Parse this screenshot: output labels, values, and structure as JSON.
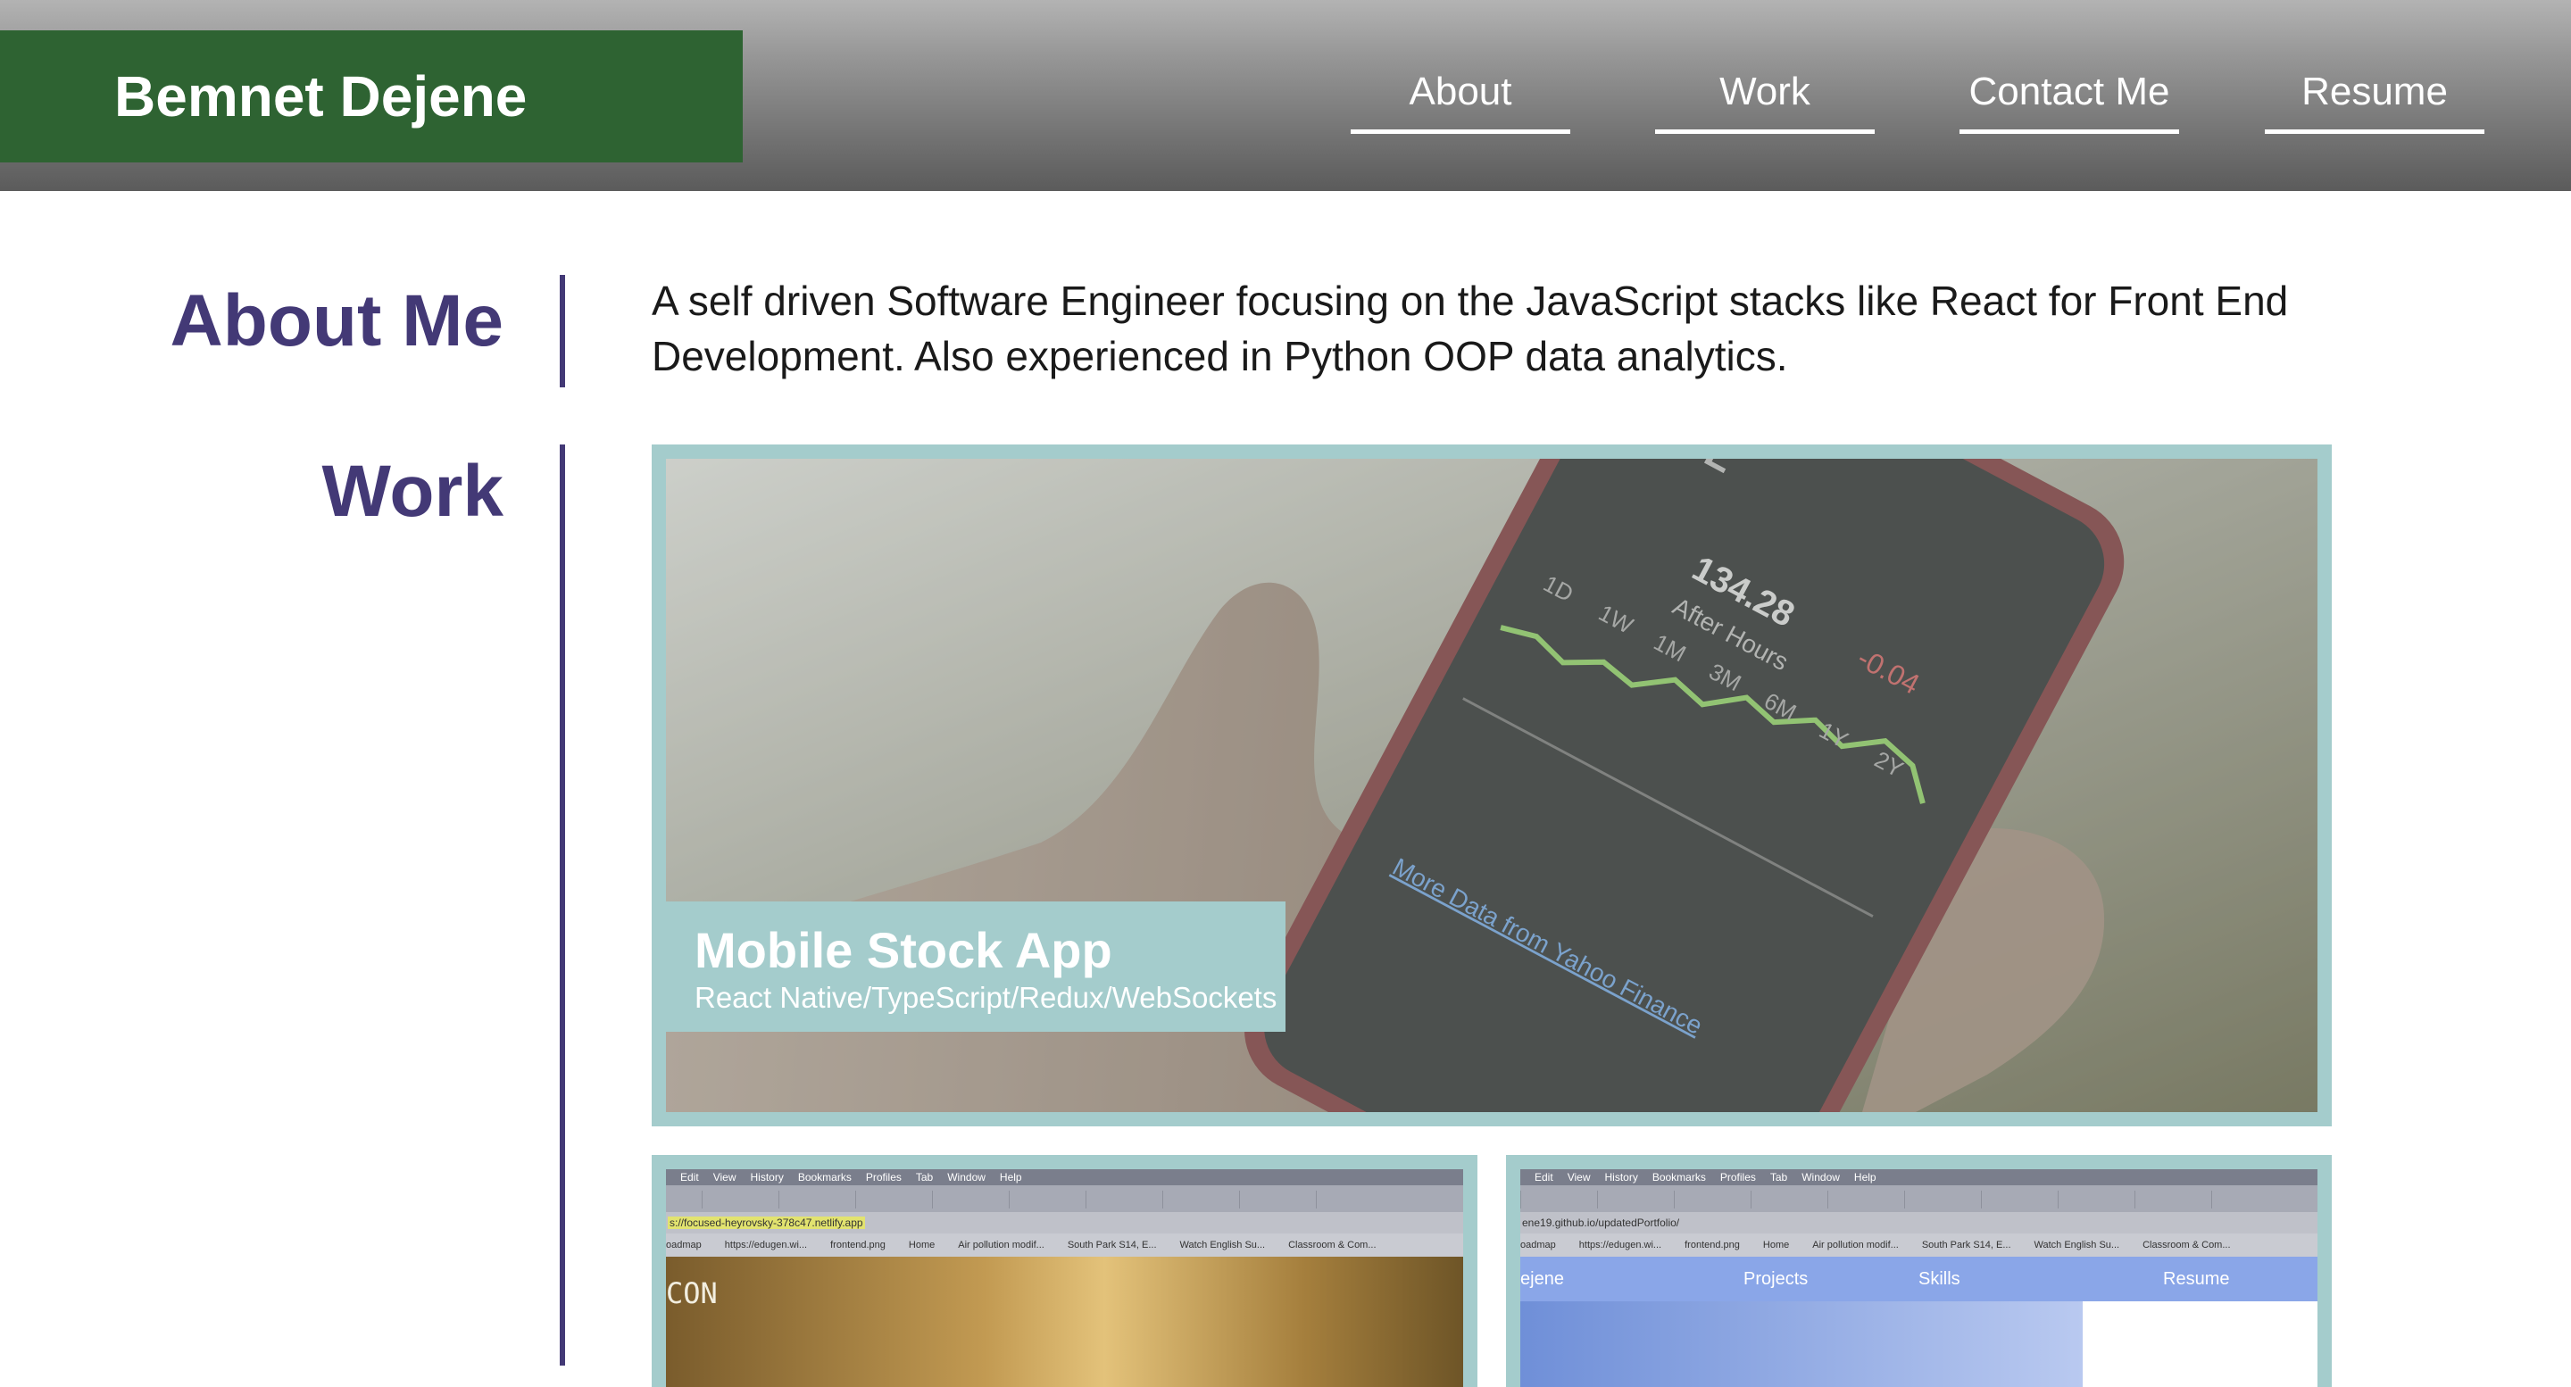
{
  "header": {
    "brand": "Bemnet Dejene",
    "nav": [
      "About",
      "Work",
      "Contact Me",
      "Resume"
    ]
  },
  "about": {
    "heading": "About Me",
    "text": "A self driven Software Engineer focusing on the JavaScript stacks like React for Front End Development. Also experienced in Python OOP data analytics."
  },
  "work": {
    "heading": "Work",
    "featured": {
      "title": "Mobile Stock App",
      "tech": "React Native/TypeScript/Redux/WebSockets",
      "phone": {
        "ticker": "AAPL",
        "price": "134.28",
        "after_hours": "After Hours",
        "change": "-0.04",
        "ranges": [
          "1D",
          "1W",
          "1M",
          "3M",
          "6M",
          "1Y",
          "2Y"
        ],
        "link": "More Data from Yahoo Finance"
      }
    },
    "thumb1": {
      "menu": [
        "Edit",
        "View",
        "History",
        "Bookmarks",
        "Profiles",
        "Tab",
        "Window",
        "Help"
      ],
      "url": "s://focused-heyrovsky-378c47.netlify.app",
      "bookmarks": [
        "oadmap",
        "https://edugen.wi...",
        "frontend.png",
        "Home",
        "Air pollution modif...",
        "South Park S14, E...",
        "Watch English Su...",
        "Classroom & Com..."
      ],
      "page_text": "CON"
    },
    "thumb2": {
      "menu": [
        "Edit",
        "View",
        "History",
        "Bookmarks",
        "Profiles",
        "Tab",
        "Window",
        "Help"
      ],
      "url": "ene19.github.io/updatedPortfolio/",
      "bookmarks": [
        "oadmap",
        "https://edugen.wi...",
        "frontend.png",
        "Home",
        "Air pollution modif...",
        "South Park S14, E...",
        "Watch English Su...",
        "Classroom & Com..."
      ],
      "nav": [
        "ejene",
        "Projects",
        "Skills",
        "Resume"
      ]
    }
  },
  "colors": {
    "brand_green": "#2e6332",
    "accent_purple": "#433976",
    "card_teal": "#a4cccc"
  }
}
